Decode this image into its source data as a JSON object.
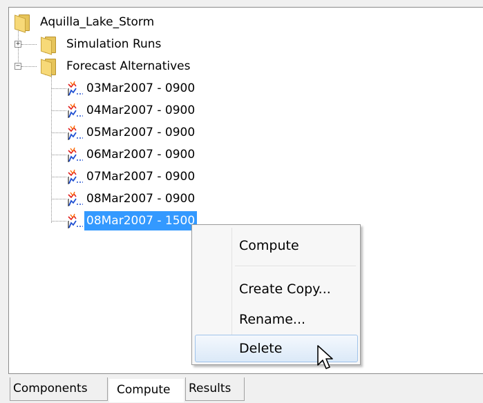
{
  "tree": {
    "root_label": "Aquilla_Lake_Storm",
    "nodes": [
      {
        "label": "Simulation Runs",
        "expanded": false
      },
      {
        "label": "Forecast Alternatives",
        "expanded": true
      }
    ],
    "forecast_items": [
      "03Mar2007 - 0900",
      "04Mar2007 - 0900",
      "05Mar2007 - 0900",
      "06Mar2007 - 0900",
      "07Mar2007 - 0900",
      "08Mar2007 - 0900",
      "08Mar2007 - 1500"
    ],
    "selected_item": "08Mar2007 - 1500",
    "expander_plus": "+",
    "expander_minus": "−"
  },
  "context_menu": {
    "items": [
      "Compute",
      "Create Copy...",
      "Rename...",
      "Delete"
    ],
    "hovered": "Delete"
  },
  "tabs": {
    "items": [
      "Components",
      "Compute",
      "Results"
    ],
    "active": "Compute"
  },
  "colors": {
    "selection": "#3399ff",
    "folder": "#f7d978",
    "menu_hover_border": "#9fc3ea"
  },
  "icons": [
    "folder-icon",
    "forecast-alternative-icon",
    "mouse-pointer-icon"
  ]
}
